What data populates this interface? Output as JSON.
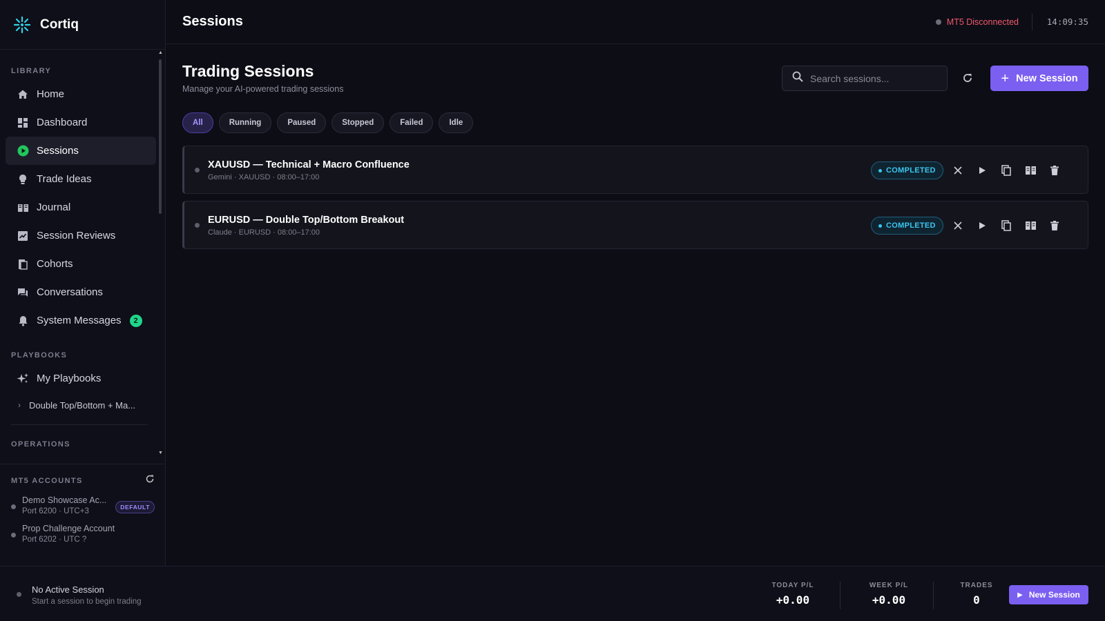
{
  "app": {
    "name": "Cortiq",
    "accent": "#7b5ff0"
  },
  "header": {
    "title": "Sessions",
    "mt5_status": "MT5 Disconnected",
    "clock": "14:09:35"
  },
  "sidebar": {
    "library_label": "LIBRARY",
    "items": [
      {
        "label": "Home",
        "icon": "home-icon"
      },
      {
        "label": "Dashboard",
        "icon": "dashboard-icon"
      },
      {
        "label": "Sessions",
        "icon": "play-circle-icon",
        "active": true
      },
      {
        "label": "Trade Ideas",
        "icon": "lightbulb-icon"
      },
      {
        "label": "Journal",
        "icon": "book-icon"
      },
      {
        "label": "Session Reviews",
        "icon": "review-icon"
      },
      {
        "label": "Cohorts",
        "icon": "cohorts-icon"
      },
      {
        "label": "Conversations",
        "icon": "chat-icon"
      },
      {
        "label": "System Messages",
        "icon": "bell-icon",
        "badge": "2"
      }
    ],
    "playbooks_label": "PLAYBOOKS",
    "playbooks": {
      "my_playbooks": "My Playbooks",
      "sub_item": "Double Top/Bottom + Ma..."
    },
    "clipped_label": "OPERATIONS"
  },
  "mt5_accounts": {
    "label": "MT5 ACCOUNTS",
    "accounts": [
      {
        "name": "Demo Showcase Ac...",
        "detail": "Port 6200 · UTC+3",
        "tag": "DEFAULT"
      },
      {
        "name": "Prop Challenge Account",
        "detail": "Port 6202 · UTC ?"
      }
    ]
  },
  "main": {
    "title": "Trading Sessions",
    "subtitle": "Manage your AI-powered trading sessions",
    "search_placeholder": "Search sessions...",
    "new_session_label": "New Session",
    "filters": [
      "All",
      "Running",
      "Paused",
      "Stopped",
      "Failed",
      "Idle"
    ],
    "active_filter": "All",
    "sessions": [
      {
        "name": "XAUUSD — Technical + Macro Confluence",
        "meta": "Gemini · XAUUSD · 08:00–17:00",
        "status": "COMPLETED"
      },
      {
        "name": "EURUSD — Double Top/Bottom Breakout",
        "meta": "Claude · EURUSD · 08:00–17:00",
        "status": "COMPLETED"
      }
    ]
  },
  "footer": {
    "no_session_title": "No Active Session",
    "no_session_sub": "Start a session to begin trading",
    "today_label": "TODAY P/L",
    "today_value": "+0.00",
    "week_label": "WEEK P/L",
    "week_value": "+0.00",
    "trades_label": "TRADES",
    "trades_value": "0",
    "new_session_label": "New Session"
  }
}
